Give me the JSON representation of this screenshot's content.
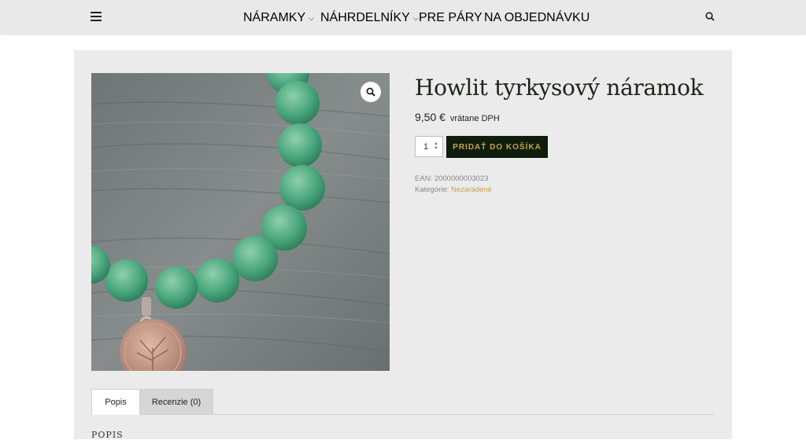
{
  "nav": {
    "items": [
      {
        "label": "NÁRAMKY",
        "has_dropdown": true
      },
      {
        "label": "NÁHRDELNÍKY",
        "has_dropdown": true
      },
      {
        "label": "PRE PÁRY",
        "has_dropdown": false
      },
      {
        "label": "NA OBJEDNÁVKU",
        "has_dropdown": false
      }
    ],
    "menu_icon": "hamburger-menu-icon",
    "search_icon": "search-icon"
  },
  "product": {
    "title": "Howlit tyrkysový náramok",
    "price": "9,50 €",
    "vat_note": "vrátane DPH",
    "quantity": "1",
    "add_to_cart_label": "PRIDAŤ DO KOŠÍKA",
    "ean_label": "EAN:",
    "ean_value": "2000000003023",
    "category_label": "Kategórie:",
    "category_value": "Nezaradené",
    "zoom_icon": "zoom-magnifier-icon"
  },
  "tabs": [
    {
      "label": "Popis",
      "active": true
    },
    {
      "label": "Recenzie (0)",
      "active": false
    }
  ],
  "section_title": "POPIS",
  "colors": {
    "header_bg": "#e9e9e9",
    "panel_bg": "#ebebeb",
    "button_bg": "#0f1d0d",
    "accent_gold": "#c9a24a"
  }
}
